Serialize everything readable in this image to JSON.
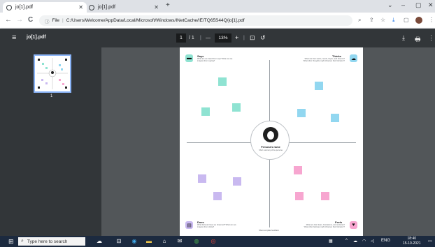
{
  "browser": {
    "tabs": [
      {
        "label": "jo[1].pdf",
        "active": true
      },
      {
        "label": "jo[1].pdf",
        "active": false
      }
    ],
    "new_tab": "+",
    "window_controls": {
      "chevron": "⌄",
      "minimize": "–",
      "maximize": "▢",
      "close": "✕"
    },
    "nav": {
      "back": "←",
      "forward": "→",
      "reload": "C"
    },
    "address": {
      "scheme": "File",
      "separator": "|",
      "url": "C:/Users/Welcome/AppData/Local/Microsoft/Windows/INetCache/IE/TQ65S44Q/jo[1].pdf"
    }
  },
  "pdf_toolbar": {
    "file_name": "jo[1].pdf",
    "page_current": "1",
    "page_total": "/ 1",
    "zoom_out": "—",
    "zoom": "13%",
    "zoom_in": "+",
    "download_icon": "⤓",
    "print_icon": "🖶",
    "more_icon": "⋮"
  },
  "sidebar": {
    "thumbnail_number": "1"
  },
  "document": {
    "quadrants": {
      "says": {
        "title": "Says",
        "subtitle": "What are we heard them say? What can we imagine them saying?"
      },
      "thinks": {
        "title": "Thinks",
        "subtitle": "What are their wants, needs, hopes, and dreams? What other thoughts might influence their behavior?"
      },
      "does": {
        "title": "Does",
        "subtitle": "What behavior have we observed? What can we imagine them doing?"
      },
      "feels": {
        "title": "Feels",
        "subtitle": "What are their fears, frustrations, and anxieties? What other feelings might influence their behavior?"
      }
    },
    "persona": {
      "name": "Persona's name",
      "description": "Short summary of the persona"
    },
    "footnote": "Share template feedback"
  },
  "taskbar": {
    "start": "⊞",
    "search_placeholder": "Type here to search",
    "search_icon": "⌕",
    "clock_time": "18:40",
    "clock_date": "15-10-2021",
    "lang": "ENG"
  },
  "colors": {
    "teal": "#8fe3d2",
    "blue": "#92d7f0",
    "lavender": "#c9b9f0",
    "pink": "#f7a6d0"
  }
}
